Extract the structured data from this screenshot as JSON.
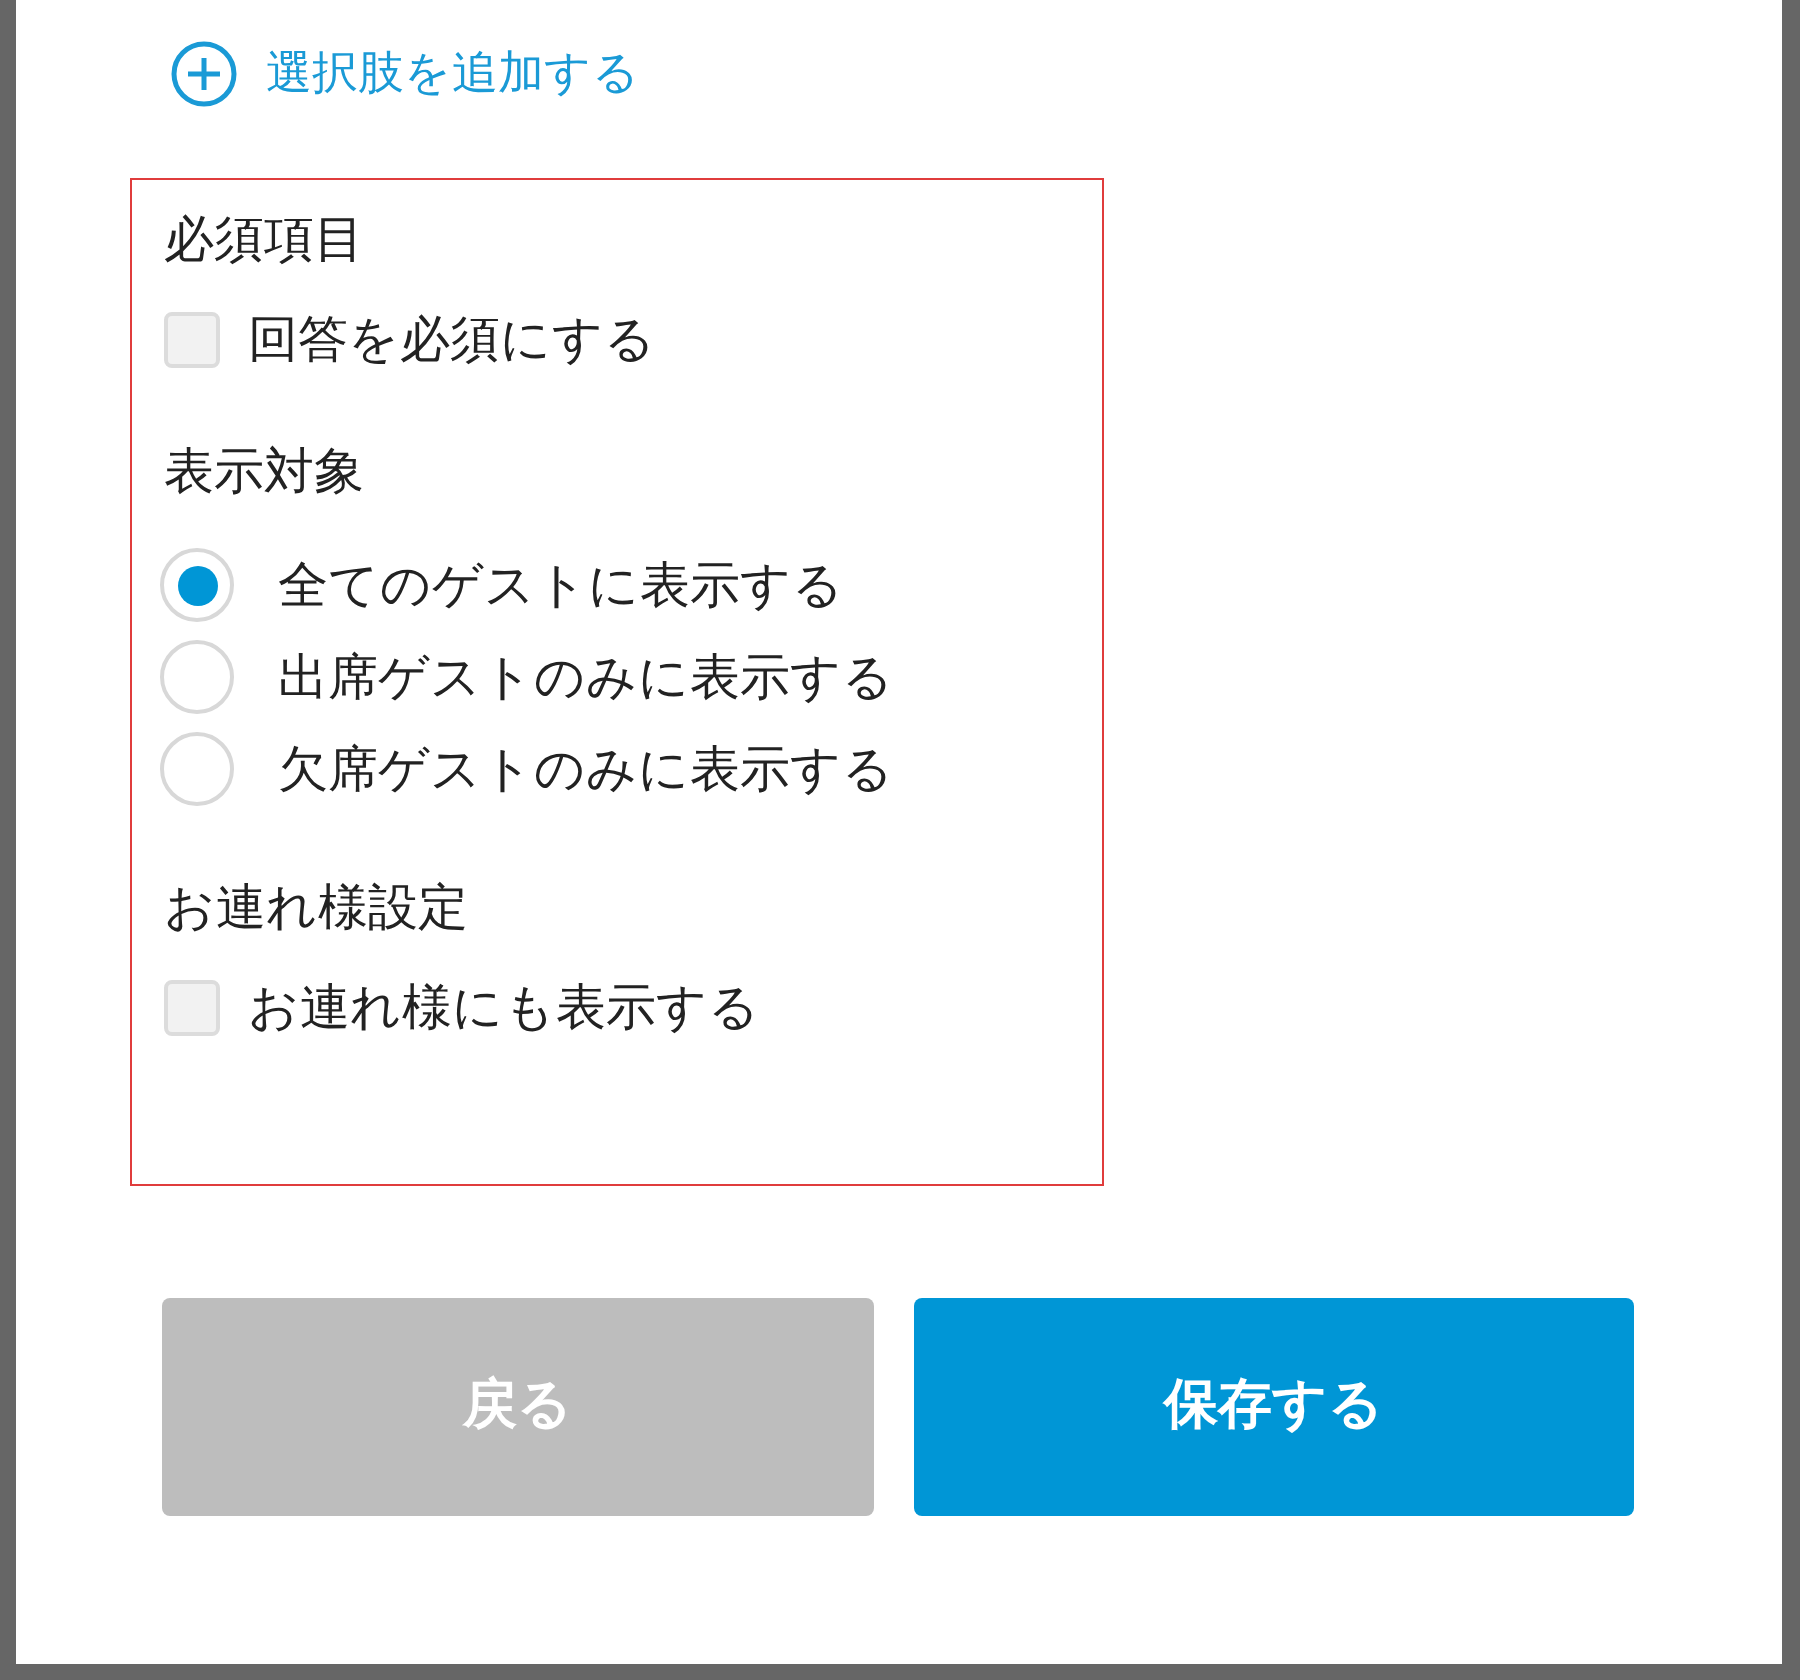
{
  "add_option": {
    "label": "選択肢を追加する"
  },
  "sections": [
    {
      "title": "必須項目",
      "kind": "checkbox",
      "options": [
        {
          "label": "回答を必須にする",
          "checked": false
        }
      ]
    },
    {
      "title": "表示対象",
      "kind": "radio",
      "options": [
        {
          "label": "全てのゲストに表示する",
          "selected": true
        },
        {
          "label": "出席ゲストのみに表示する",
          "selected": false
        },
        {
          "label": "欠席ゲストのみに表示する",
          "selected": false
        }
      ]
    },
    {
      "title": "お連れ様設定",
      "kind": "checkbox",
      "options": [
        {
          "label": "お連れ様にも表示する",
          "checked": false
        }
      ]
    }
  ],
  "buttons": [
    {
      "label": "戻る",
      "kind": "secondary"
    },
    {
      "label": "保存する",
      "kind": "primary"
    }
  ]
}
